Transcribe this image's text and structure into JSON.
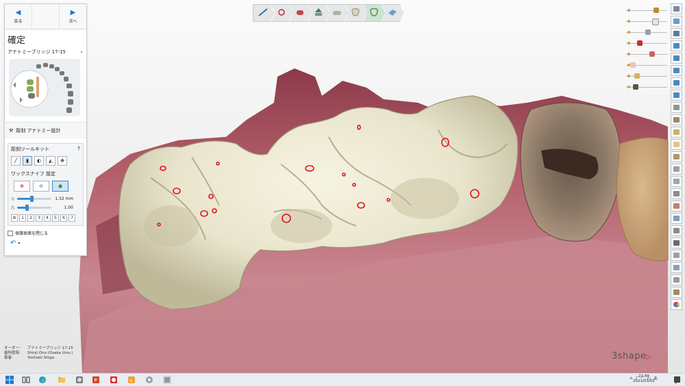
{
  "nav": {
    "back_label": "戻る",
    "next_label": "次へ"
  },
  "panel": {
    "title": "確定",
    "workflow_name": "アナトミーブリッジ 17-15",
    "section_label": "彫刻 アナトミー設計",
    "toolkit": {
      "title": "彫刻ツールキット",
      "help": "?"
    },
    "wax_knife": {
      "title": "ワックスナイフ 設定",
      "radius_value": "1.32 mm",
      "strength_value": "1.00",
      "radius_fraction": 0.42,
      "strength_fraction": 0.28,
      "presets": [
        "1",
        "2",
        "3",
        "4",
        "5",
        "6",
        "7"
      ]
    },
    "protect_checkbox_label": "保護表面を閉じる"
  },
  "order_info": {
    "rows": [
      {
        "key": "オーダー:",
        "value": "アナトミーブリッジ 17-15"
      },
      {
        "key": "歯科医院:",
        "value": "Shinji Ono (Osaka Univ.)"
      },
      {
        "key": "患者:",
        "value": "Yoshiaki Shiga"
      }
    ]
  },
  "brand": {
    "name": "3shape",
    "mark": "▷"
  },
  "taskbar": {
    "time": "22:49",
    "date": "2021/03/02"
  },
  "colors": {
    "accent": "#1e78c8",
    "crown": "#ebe7d0",
    "gingiva": "#b05a68",
    "margin_marks": "#e0101a",
    "brand_mark": "#d4232a"
  },
  "icons": {
    "workflow_steps": [
      "margin-line-icon",
      "insertion-direction-icon",
      "abutment-icon",
      "tooth-design-icon",
      "connector-icon",
      "anatomy-icon",
      "sculpt-icon",
      "finish-icon"
    ],
    "right_toolbar": [
      "fit-view-icon",
      "zoom-icon",
      "camera-icon",
      "view-top-icon",
      "view-front-icon",
      "view-back-icon",
      "view-left-icon",
      "view-right-icon",
      "clip-plane-icon",
      "measure-icon",
      "crown-icon",
      "occlusion-icon",
      "cross-section-icon",
      "scan-icon",
      "mesh-icon",
      "surface-icon",
      "gingiva-icon",
      "texture-icon",
      "screenshot-icon",
      "record-icon",
      "down-arrow-icon",
      "link-icon",
      "settings-icon",
      "tools-icon",
      "color-icon"
    ]
  }
}
